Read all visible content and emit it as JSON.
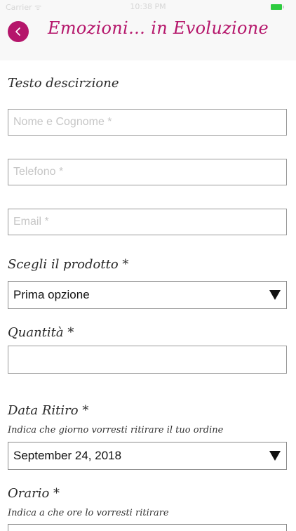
{
  "status_bar": {
    "carrier": "Carrier ᯤ",
    "time": "10:38 PM"
  },
  "nav": {
    "title": "Emozioni… in Evoluzione",
    "back_icon": "chevron-left-icon",
    "accent_color": "#b5166b"
  },
  "form": {
    "description": "Testo descirzione",
    "name_placeholder": "Nome e Cognome *",
    "phone_placeholder": "Telefono *",
    "email_placeholder": "Email *",
    "product_label": "Scegli il prodotto *",
    "product_value": "Prima opzione",
    "quantity_label": "Quantità *",
    "quantity_value": "",
    "date_label": "Data Ritiro *",
    "date_hint": "Indica che giorno vorresti ritirare il tuo ordine",
    "date_value": "September 24, 2018",
    "time_label": "Orario *",
    "time_hint": "Indica a che ore lo vorresti ritirare"
  }
}
